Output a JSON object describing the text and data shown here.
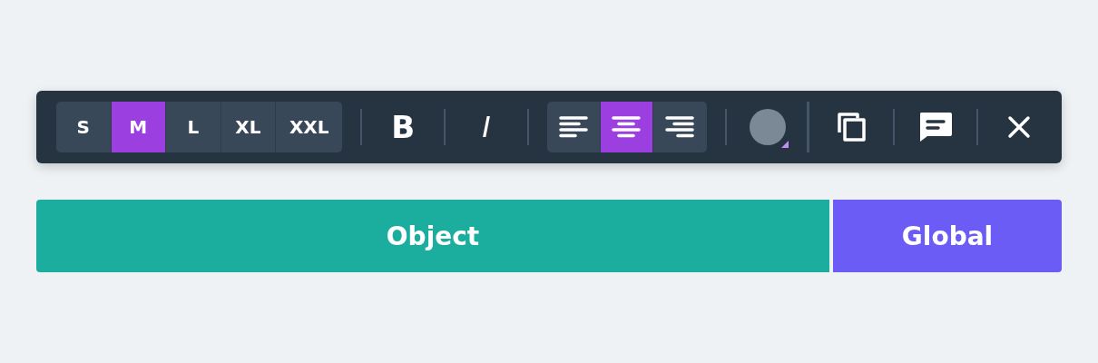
{
  "toolbar": {
    "sizes": [
      {
        "label": "S",
        "selected": false
      },
      {
        "label": "M",
        "selected": true
      },
      {
        "label": "L",
        "selected": false
      },
      {
        "label": "XL",
        "selected": false
      },
      {
        "label": "XXL",
        "selected": false
      }
    ],
    "bold": "B",
    "italic": "I",
    "alignments": [
      {
        "kind": "left",
        "selected": false
      },
      {
        "kind": "center",
        "selected": true
      },
      {
        "kind": "right",
        "selected": false
      }
    ],
    "color": "#7b8896"
  },
  "scope_buttons": [
    {
      "label": "Object",
      "color": "#1bae9f"
    },
    {
      "label": "Global",
      "color": "#6b5cf5"
    }
  ]
}
